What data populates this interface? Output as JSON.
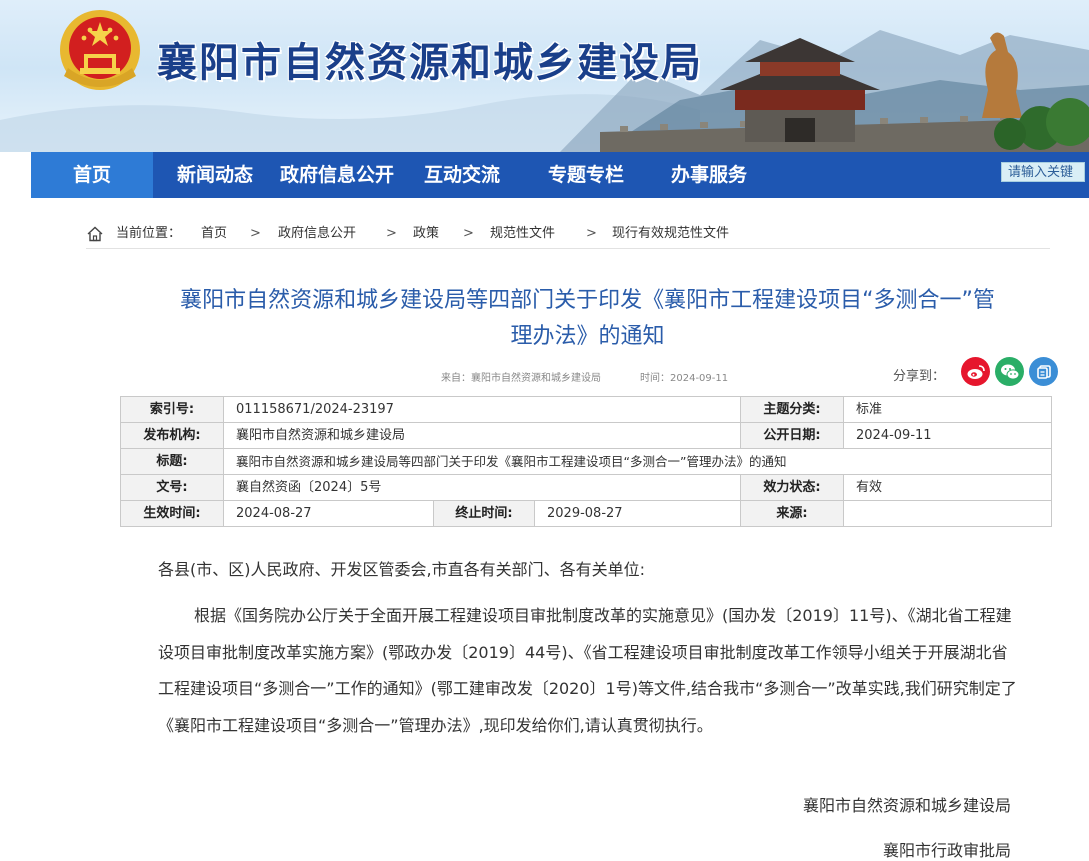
{
  "site": {
    "name": "襄阳市自然资源和城乡建设局"
  },
  "nav": {
    "items": [
      {
        "label": "首页",
        "active": true
      },
      {
        "label": "新闻动态"
      },
      {
        "label": "政府信息公开"
      },
      {
        "label": "互动交流"
      },
      {
        "label": "专题专栏"
      },
      {
        "label": "办事服务"
      }
    ],
    "search_placeholder": "请输入关键"
  },
  "breadcrumb": {
    "label": "当前位置：",
    "items": [
      "首页",
      "政府信息公开",
      "政策",
      "规范性文件",
      "现行有效规范性文件"
    ],
    "separator": ">"
  },
  "article": {
    "title_line1": "襄阳市自然资源和城乡建设局等四部门关于印发《襄阳市工程建设项目“多测合一”管",
    "title_line2": "理办法》的通知",
    "source": "来自：襄阳市自然资源和城乡建设局",
    "time": "时间：2024-09-11",
    "share_label": "分享到："
  },
  "info": {
    "index_label": "索引号:",
    "index_value": "011158671/2024-23197",
    "topic_label": "主题分类:",
    "topic_value": "标准",
    "publisher_label": "发布机构:",
    "publisher_value": "襄阳市自然资源和城乡建设局",
    "pubdate_label": "公开日期:",
    "pubdate_value": "2024-09-11",
    "title_label": "标题:",
    "title_value": "襄阳市自然资源和城乡建设局等四部门关于印发《襄阳市工程建设项目“多测合一”管理办法》的通知",
    "docno_label": "文号:",
    "docno_value": "襄自然资函〔2024〕5号",
    "validity_label": "效力状态:",
    "validity_value": "有效",
    "effective_label": "生效时间:",
    "effective_value": "2024-08-27",
    "end_label": "终止时间:",
    "end_value": "2029-08-27",
    "src_label": "来源:",
    "src_value": ""
  },
  "body": {
    "salutation": "各县(市、区)人民政府、开发区管委会,市直各有关部门、各有关单位:",
    "paragraph": "根据《国务院办公厅关于全面开展工程建设项目审批制度改革的实施意见》(国办发〔2019〕11号)、《湖北省工程建设项目审批制度改革实施方案》(鄂政办发〔2019〕44号)、《省工程建设项目审批制度改革工作领导小组关于开展湖北省工程建设项目“多测合一”工作的通知》(鄂工建审改发〔2020〕1号)等文件,结合我市“多测合一”改革实践,我们研究制定了《襄阳市工程建设项目“多测合一”管理办法》,现印发给你们,请认真贯彻执行。",
    "signature1": "襄阳市自然资源和城乡建设局",
    "signature2": "襄阳市行政审批局"
  },
  "colors": {
    "nav_bg": "#1e56b3",
    "nav_active": "#2e7bd6",
    "title_blue": "#2a5caa",
    "weibo": "#e6162d",
    "wechat": "#2aae67",
    "other_share": "#3b8ed6"
  }
}
